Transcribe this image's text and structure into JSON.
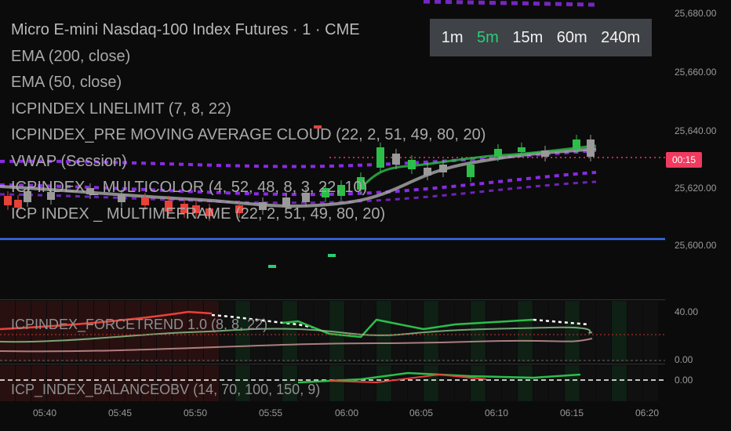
{
  "header": {
    "symbol_title": "Micro E-mini Nasdaq-100 Index Futures · 1 · CME"
  },
  "indicators": [
    "EMA (200, close)",
    "EMA (50, close)",
    "ICPINDEX LINELIMIT (7, 8, 22)",
    "ICPINDEX_PRE MOVING AVERAGE CLOUD (22, 2, 51, 49, 80, 20)",
    "VWAP (Session)",
    "ICPINDEX _ MULTICOLOR (4, 52, 48, 8, 3, 22, 10)",
    "ICP INDEX _ MULTIMEFRAME (22, 2, 51, 49, 80, 20)"
  ],
  "timeframes": {
    "items": [
      "1m",
      "5m",
      "15m",
      "60m",
      "240m"
    ],
    "active": "5m"
  },
  "price_axis": {
    "labels": [
      "25,680.00",
      "25,660.00",
      "25,640.00",
      "25,620.00",
      "25,600.00"
    ],
    "current_badge": "00:15"
  },
  "lower_panes": {
    "pane1_label": "ICPINDEX_FORCETREND 1.0 (8, 8, 22)",
    "pane1_axis_top": "40.00",
    "pane1_axis_bottom": "0.00",
    "pane2_label": "ICP_INDEX_BALANCEOBV (14, 70, 100, 150, 9)",
    "pane2_axis": "0.00"
  },
  "time_axis": [
    "05:40",
    "05:45",
    "05:50",
    "05:55",
    "06:00",
    "06:05",
    "06:10",
    "06:15",
    "06:20"
  ],
  "colors": {
    "up": "#2dbe4a",
    "down": "#e8413a",
    "neutral": "#9a9a9a",
    "cloud": "#8a2be2",
    "blue_line": "#3a6ef0",
    "price_line": "#f03a5f",
    "active_tf": "#26d07c"
  },
  "chart_data": {
    "type": "candlestick",
    "price_range": [
      25590,
      25685
    ],
    "vwap_level": 25603,
    "current_price": 25631
  }
}
